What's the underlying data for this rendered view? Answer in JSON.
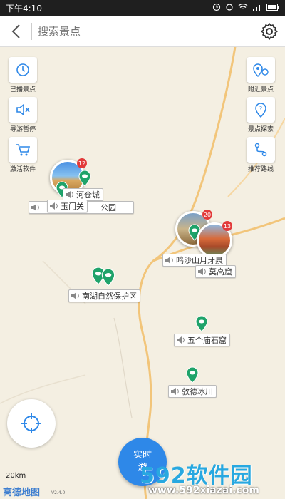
{
  "status_bar": {
    "time": "下午4:10",
    "icons": [
      "alarm-icon",
      "wifi-icon",
      "signal-icon",
      "battery-icon"
    ]
  },
  "header": {
    "search_placeholder": "搜索景点"
  },
  "tools_left": [
    {
      "label": "已播景点",
      "icon": "history-icon"
    },
    {
      "label": "导游暂停",
      "icon": "mute-icon"
    },
    {
      "label": "激活软件",
      "icon": "cart-icon"
    }
  ],
  "tools_right": [
    {
      "label": "附近景点",
      "icon": "nearby-pins-icon"
    },
    {
      "label": "景点探索",
      "icon": "question-pin-icon"
    },
    {
      "label": "推荐路线",
      "icon": "route-icon"
    }
  ],
  "spots": {
    "hecangcheng": "河仓城",
    "yumenguan": "玉门关",
    "gongyuan": "公园",
    "mingshashan": "鸣沙山月牙泉",
    "mogaoku": "莫高窟",
    "nanhu": "南湖自然保护区",
    "wugemiao": "五个庙石窟",
    "dunhuang_bingchuan": "敦德冰川"
  },
  "badges": {
    "west": "12",
    "east_a": "20",
    "east_b": "13"
  },
  "map": {
    "scale": "20km",
    "logo": "高德地图",
    "version": "V2.4.0"
  },
  "realtime": {
    "label": "实时游"
  },
  "watermark": {
    "brand": "592软件园",
    "url": "www.592xiazai.com"
  },
  "colors": {
    "accent": "#2e88e8",
    "pin": "#1fa36a",
    "badge": "#e23a3a",
    "road": "#f2c57a"
  }
}
